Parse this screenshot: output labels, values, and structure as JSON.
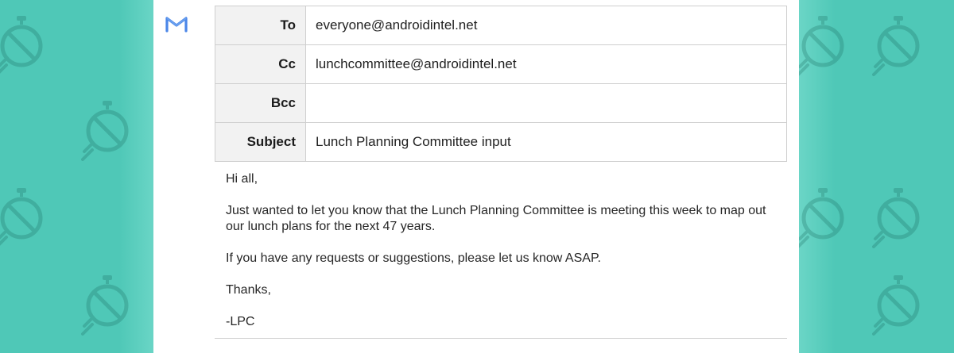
{
  "colors": {
    "background": "#4fc8b7",
    "panel": "#ffffff",
    "label_bg": "#f2f2f2",
    "border": "#cfcfcf",
    "logo": "#4a86e8"
  },
  "app": {
    "logo_icon": "gmail-m-icon"
  },
  "fields": {
    "to": {
      "label": "To",
      "value": "everyone@androidintel.net"
    },
    "cc": {
      "label": "Cc",
      "value": "lunchcommittee@androidintel.net"
    },
    "bcc": {
      "label": "Bcc",
      "value": ""
    },
    "subject": {
      "label": "Subject",
      "value": "Lunch Planning Committee input"
    }
  },
  "message": {
    "greeting": "Hi all,",
    "paragraph1": "Just wanted to let you know that the Lunch Planning Committee is meeting this week to map out our lunch plans for the next 47 years.",
    "paragraph2": "If you have any requests or suggestions, please let us know ASAP.",
    "closing": "Thanks,",
    "signature": "-LPC"
  },
  "background_pattern_icon": "android-timer-icon"
}
